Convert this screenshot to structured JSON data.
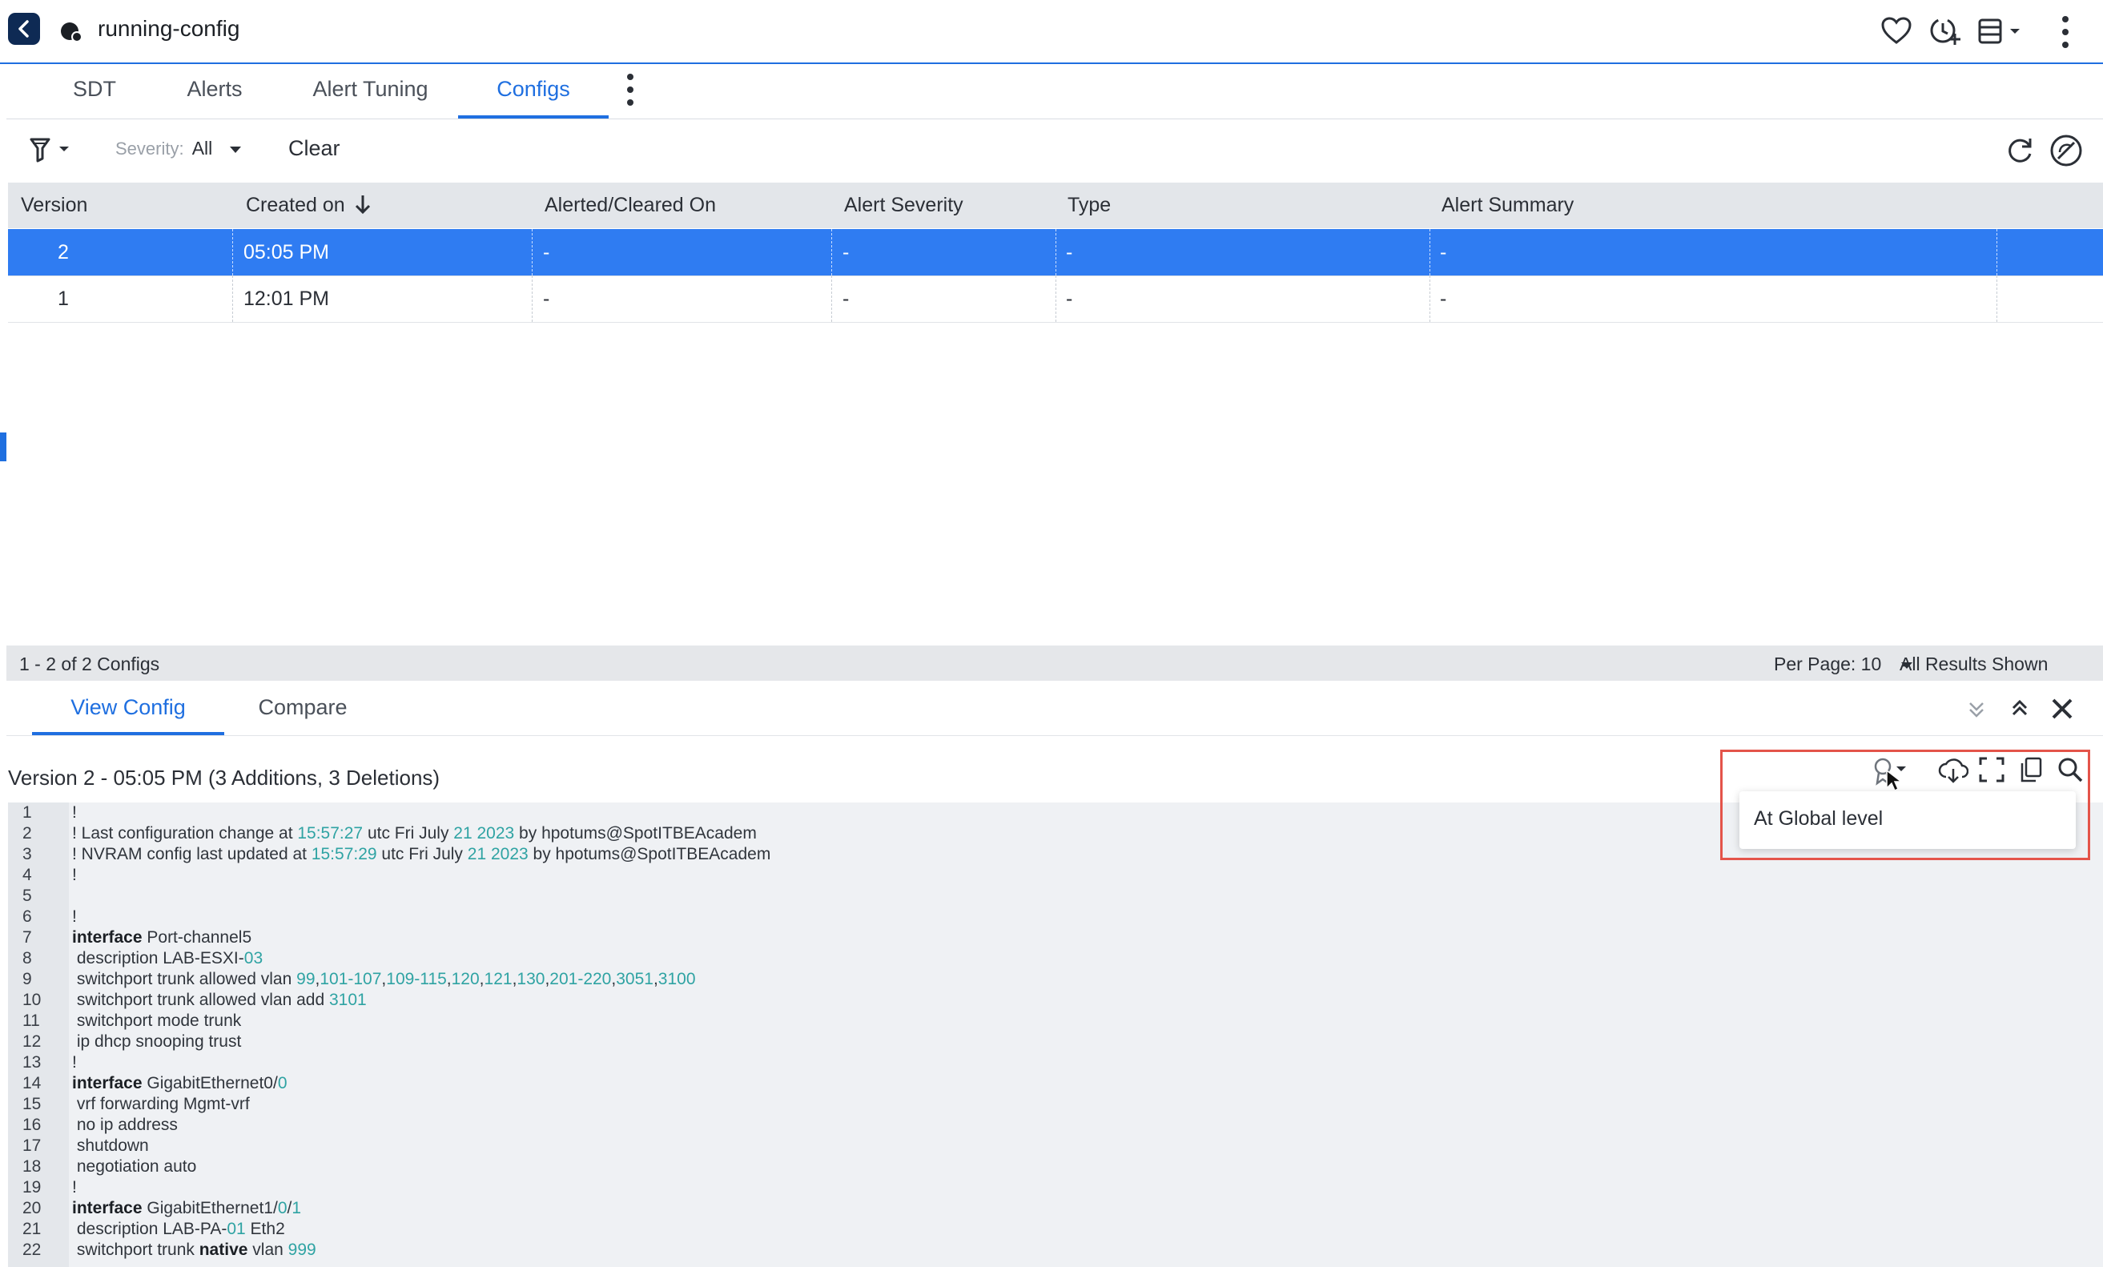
{
  "header": {
    "title": "running-config"
  },
  "tabs": [
    {
      "label": "SDT"
    },
    {
      "label": "Alerts"
    },
    {
      "label": "Alert Tuning"
    },
    {
      "label": "Configs"
    }
  ],
  "filter": {
    "severity_label": "Severity:",
    "severity_value": "All",
    "clear_label": "Clear"
  },
  "table": {
    "columns": [
      "Version",
      "Created on",
      "Alerted/Cleared On",
      "Alert Severity",
      "Type",
      "Alert Summary"
    ],
    "rows": [
      {
        "version": "2",
        "created": "05:05 PM",
        "alerted": "-",
        "severity": "-",
        "type": "-",
        "summary": "-"
      },
      {
        "version": "1",
        "created": "12:01 PM",
        "alerted": "-",
        "severity": "-",
        "type": "-",
        "summary": "-"
      }
    ],
    "count_text": "1 - 2 of 2 Configs",
    "per_page_label": "Per Page: 10",
    "results_text": "All Results Shown"
  },
  "bottom_tabs": [
    {
      "label": "View Config"
    },
    {
      "label": "Compare"
    }
  ],
  "config_view": {
    "title": "Version 2 - 05:05 PM (3 Additions, 3 Deletions)",
    "dropdown_item": "At Global level"
  },
  "code": {
    "line_numbers": [
      "1",
      "2",
      "3",
      "4",
      "5",
      "6",
      "7",
      "8",
      "9",
      "10",
      "11",
      "12",
      "13",
      "14",
      "15",
      "16",
      "17",
      "18",
      "19",
      "20",
      "21",
      "22"
    ]
  },
  "colors": {
    "accent": "#1f6fe0",
    "selected_row": "#2f7cf2",
    "highlight_border": "#e4544a",
    "number_teal": "#2fa3a3"
  }
}
